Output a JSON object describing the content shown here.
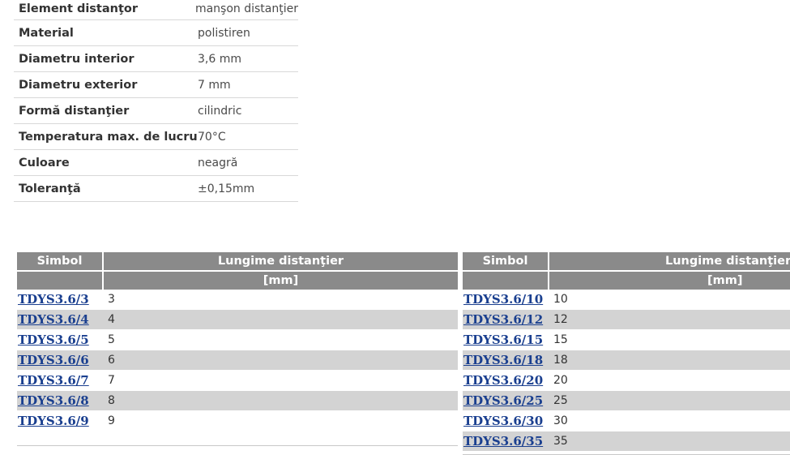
{
  "specs": [
    {
      "label": "Element distanţor",
      "value": "manşon distanţier"
    },
    {
      "label": "Material",
      "value": "polistiren"
    },
    {
      "label": "Diametru interior",
      "value": "3,6 mm"
    },
    {
      "label": "Diametru exterior",
      "value": "7 mm"
    },
    {
      "label": "Formă distanţier",
      "value": "cilindric"
    },
    {
      "label": "Temperatura max. de lucru",
      "value": "70°C"
    },
    {
      "label": "Culoare",
      "value": "neagră"
    },
    {
      "label": "Toleranţă",
      "value": "±0,15mm"
    }
  ],
  "table_left": {
    "header_symbol": "Simbol",
    "header_length": "Lungime distanţier",
    "header_unit": "[mm]",
    "rows": [
      {
        "symbol": "TDYS3.6/3",
        "length": "3"
      },
      {
        "symbol": "TDYS3.6/4",
        "length": "4"
      },
      {
        "symbol": "TDYS3.6/5",
        "length": "5"
      },
      {
        "symbol": "TDYS3.6/6",
        "length": "6"
      },
      {
        "symbol": "TDYS3.6/7",
        "length": "7"
      },
      {
        "symbol": "TDYS3.6/8",
        "length": "8"
      },
      {
        "symbol": "TDYS3.6/9",
        "length": "9"
      }
    ]
  },
  "table_right": {
    "header_symbol": "Simbol",
    "header_length": "Lungime distanţier",
    "header_unit": "[mm]",
    "rows": [
      {
        "symbol": "TDYS3.6/10",
        "length": "10"
      },
      {
        "symbol": "TDYS3.6/12",
        "length": "12"
      },
      {
        "symbol": "TDYS3.6/15",
        "length": "15"
      },
      {
        "symbol": "TDYS3.6/18",
        "length": "18"
      },
      {
        "symbol": "TDYS3.6/20",
        "length": "20"
      },
      {
        "symbol": "TDYS3.6/25",
        "length": "25"
      },
      {
        "symbol": "TDYS3.6/30",
        "length": "30"
      },
      {
        "symbol": "TDYS3.6/35",
        "length": "35"
      }
    ]
  },
  "colors": {
    "header_bg": "#8a8a8a",
    "alt_row_bg": "#d3d3d3",
    "link": "#1a3f8f"
  }
}
